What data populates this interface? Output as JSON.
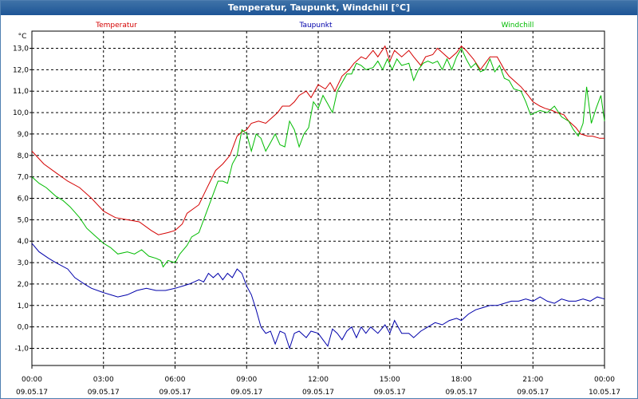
{
  "window": {
    "title": "Temperatur, Taupunkt, Windchill [°C]"
  },
  "chart_data": {
    "type": "line",
    "ylabel": "°C",
    "ylim": [
      -1.8,
      13.8
    ],
    "yticks": [
      -1.0,
      0.0,
      1.0,
      2.0,
      3.0,
      4.0,
      5.0,
      6.0,
      7.0,
      8.0,
      9.0,
      10.0,
      11.0,
      12.0,
      13.0
    ],
    "ytick_labels": [
      "-1,0",
      "0,0",
      "1,0",
      "2,0",
      "3,0",
      "4,0",
      "5,0",
      "6,0",
      "7,0",
      "8,0",
      "9,0",
      "10,0",
      "11,0",
      "12,0",
      "13,0"
    ],
    "xlim": [
      0,
      24
    ],
    "xticks": [
      0,
      3,
      6,
      9,
      12,
      15,
      18,
      21,
      24
    ],
    "xtick_labels": [
      {
        "time": "00:00",
        "date": "09.05.17"
      },
      {
        "time": "03:00",
        "date": "09.05.17"
      },
      {
        "time": "06:00",
        "date": "09.05.17"
      },
      {
        "time": "09:00",
        "date": "09.05.17"
      },
      {
        "time": "12:00",
        "date": "09.05.17"
      },
      {
        "time": "15:00",
        "date": "09.05.17"
      },
      {
        "time": "18:00",
        "date": "09.05.17"
      },
      {
        "time": "21:00",
        "date": "09.05.17"
      },
      {
        "time": "00:00",
        "date": "10.05.17"
      }
    ],
    "grid": true,
    "series": [
      {
        "name": "Temperatur",
        "color": "#d40000",
        "points": [
          [
            0,
            8.2
          ],
          [
            0.5,
            7.6
          ],
          [
            1,
            7.2
          ],
          [
            1.5,
            6.8
          ],
          [
            2,
            6.5
          ],
          [
            2.5,
            6.0
          ],
          [
            3,
            5.4
          ],
          [
            3.5,
            5.1
          ],
          [
            4,
            5.0
          ],
          [
            4.5,
            4.9
          ],
          [
            5,
            4.5
          ],
          [
            5.3,
            4.3
          ],
          [
            5.7,
            4.4
          ],
          [
            6,
            4.5
          ],
          [
            6.3,
            4.8
          ],
          [
            6.5,
            5.3
          ],
          [
            7,
            5.7
          ],
          [
            7.3,
            6.4
          ],
          [
            7.7,
            7.3
          ],
          [
            8,
            7.6
          ],
          [
            8.3,
            8.0
          ],
          [
            8.6,
            8.9
          ],
          [
            8.8,
            9.1
          ],
          [
            9,
            9.2
          ],
          [
            9.2,
            9.5
          ],
          [
            9.5,
            9.6
          ],
          [
            9.8,
            9.5
          ],
          [
            10,
            9.7
          ],
          [
            10.3,
            10.0
          ],
          [
            10.5,
            10.3
          ],
          [
            10.8,
            10.3
          ],
          [
            11,
            10.5
          ],
          [
            11.2,
            10.8
          ],
          [
            11.5,
            11.0
          ],
          [
            11.7,
            10.7
          ],
          [
            12,
            11.3
          ],
          [
            12.3,
            11.1
          ],
          [
            12.5,
            11.4
          ],
          [
            12.7,
            11.0
          ],
          [
            13,
            11.7
          ],
          [
            13.3,
            12.0
          ],
          [
            13.5,
            12.3
          ],
          [
            13.8,
            12.6
          ],
          [
            14,
            12.5
          ],
          [
            14.3,
            12.9
          ],
          [
            14.5,
            12.6
          ],
          [
            14.8,
            13.1
          ],
          [
            15,
            12.4
          ],
          [
            15.2,
            12.9
          ],
          [
            15.5,
            12.6
          ],
          [
            15.8,
            12.9
          ],
          [
            16,
            12.6
          ],
          [
            16.3,
            12.2
          ],
          [
            16.5,
            12.6
          ],
          [
            16.8,
            12.7
          ],
          [
            17,
            13.0
          ],
          [
            17.2,
            12.8
          ],
          [
            17.5,
            12.5
          ],
          [
            17.8,
            12.8
          ],
          [
            18,
            13.1
          ],
          [
            18.2,
            12.9
          ],
          [
            18.5,
            12.5
          ],
          [
            18.8,
            12.0
          ],
          [
            19,
            12.3
          ],
          [
            19.2,
            12.6
          ],
          [
            19.5,
            12.6
          ],
          [
            19.8,
            12.0
          ],
          [
            20,
            11.7
          ],
          [
            20.3,
            11.4
          ],
          [
            20.5,
            11.2
          ],
          [
            20.8,
            10.8
          ],
          [
            21,
            10.5
          ],
          [
            21.3,
            10.3
          ],
          [
            21.5,
            10.2
          ],
          [
            21.8,
            10.1
          ],
          [
            22,
            10.0
          ],
          [
            22.3,
            9.9
          ],
          [
            22.5,
            9.6
          ],
          [
            22.8,
            9.3
          ],
          [
            23,
            9.0
          ],
          [
            23.3,
            8.9
          ],
          [
            23.5,
            8.9
          ],
          [
            23.8,
            8.8
          ],
          [
            24,
            8.8
          ]
        ]
      },
      {
        "name": "Taupunkt",
        "color": "#0000aa",
        "points": [
          [
            0,
            3.9
          ],
          [
            0.3,
            3.5
          ],
          [
            0.7,
            3.2
          ],
          [
            1,
            3.0
          ],
          [
            1.5,
            2.7
          ],
          [
            1.8,
            2.3
          ],
          [
            2.2,
            2.0
          ],
          [
            2.5,
            1.8
          ],
          [
            3,
            1.6
          ],
          [
            3.3,
            1.5
          ],
          [
            3.6,
            1.4
          ],
          [
            4,
            1.5
          ],
          [
            4.4,
            1.7
          ],
          [
            4.8,
            1.8
          ],
          [
            5.2,
            1.7
          ],
          [
            5.6,
            1.7
          ],
          [
            6,
            1.8
          ],
          [
            6.3,
            1.9
          ],
          [
            6.6,
            2.0
          ],
          [
            6.8,
            2.1
          ],
          [
            7,
            2.2
          ],
          [
            7.2,
            2.1
          ],
          [
            7.4,
            2.5
          ],
          [
            7.6,
            2.3
          ],
          [
            7.8,
            2.5
          ],
          [
            8,
            2.2
          ],
          [
            8.2,
            2.5
          ],
          [
            8.4,
            2.3
          ],
          [
            8.6,
            2.7
          ],
          [
            8.8,
            2.5
          ],
          [
            9,
            1.9
          ],
          [
            9.2,
            1.5
          ],
          [
            9.4,
            0.8
          ],
          [
            9.6,
            0.0
          ],
          [
            9.8,
            -0.3
          ],
          [
            10,
            -0.2
          ],
          [
            10.2,
            -0.8
          ],
          [
            10.4,
            -0.2
          ],
          [
            10.6,
            -0.3
          ],
          [
            10.8,
            -1.0
          ],
          [
            11,
            -0.3
          ],
          [
            11.2,
            -0.2
          ],
          [
            11.5,
            -0.5
          ],
          [
            11.7,
            -0.2
          ],
          [
            12,
            -0.3
          ],
          [
            12.2,
            -0.6
          ],
          [
            12.4,
            -0.9
          ],
          [
            12.6,
            -0.1
          ],
          [
            12.8,
            -0.3
          ],
          [
            13,
            -0.6
          ],
          [
            13.2,
            -0.2
          ],
          [
            13.4,
            0.0
          ],
          [
            13.6,
            -0.5
          ],
          [
            13.8,
            0.0
          ],
          [
            14,
            -0.3
          ],
          [
            14.2,
            0.0
          ],
          [
            14.5,
            -0.3
          ],
          [
            14.8,
            0.1
          ],
          [
            15,
            -0.3
          ],
          [
            15.2,
            0.3
          ],
          [
            15.5,
            -0.3
          ],
          [
            15.8,
            -0.3
          ],
          [
            16,
            -0.5
          ],
          [
            16.3,
            -0.2
          ],
          [
            16.6,
            0.0
          ],
          [
            16.9,
            0.2
          ],
          [
            17.2,
            0.1
          ],
          [
            17.5,
            0.3
          ],
          [
            17.8,
            0.4
          ],
          [
            18,
            0.3
          ],
          [
            18.3,
            0.6
          ],
          [
            18.6,
            0.8
          ],
          [
            18.9,
            0.9
          ],
          [
            19.2,
            1.0
          ],
          [
            19.5,
            1.0
          ],
          [
            19.8,
            1.1
          ],
          [
            20.1,
            1.2
          ],
          [
            20.4,
            1.2
          ],
          [
            20.7,
            1.3
          ],
          [
            21,
            1.2
          ],
          [
            21.3,
            1.4
          ],
          [
            21.6,
            1.2
          ],
          [
            21.9,
            1.1
          ],
          [
            22.2,
            1.3
          ],
          [
            22.5,
            1.2
          ],
          [
            22.8,
            1.2
          ],
          [
            23.1,
            1.3
          ],
          [
            23.4,
            1.2
          ],
          [
            23.7,
            1.4
          ],
          [
            24,
            1.3
          ]
        ]
      },
      {
        "name": "Windchill",
        "color": "#00bb00",
        "points": [
          [
            0,
            7.0
          ],
          [
            0.3,
            6.7
          ],
          [
            0.6,
            6.5
          ],
          [
            1,
            6.1
          ],
          [
            1.3,
            5.9
          ],
          [
            1.6,
            5.6
          ],
          [
            2,
            5.1
          ],
          [
            2.3,
            4.6
          ],
          [
            2.6,
            4.3
          ],
          [
            3,
            3.9
          ],
          [
            3.3,
            3.7
          ],
          [
            3.6,
            3.4
          ],
          [
            4,
            3.5
          ],
          [
            4.3,
            3.4
          ],
          [
            4.6,
            3.6
          ],
          [
            4.9,
            3.3
          ],
          [
            5.2,
            3.2
          ],
          [
            5.4,
            3.1
          ],
          [
            5.5,
            2.8
          ],
          [
            5.7,
            3.1
          ],
          [
            6,
            3.0
          ],
          [
            6.2,
            3.4
          ],
          [
            6.5,
            3.8
          ],
          [
            6.7,
            4.2
          ],
          [
            7,
            4.4
          ],
          [
            7.2,
            5.0
          ],
          [
            7.5,
            5.9
          ],
          [
            7.8,
            6.8
          ],
          [
            8,
            6.8
          ],
          [
            8.2,
            6.7
          ],
          [
            8.4,
            7.6
          ],
          [
            8.6,
            8.0
          ],
          [
            8.8,
            9.2
          ],
          [
            9,
            9.0
          ],
          [
            9.2,
            8.2
          ],
          [
            9.4,
            9.0
          ],
          [
            9.6,
            8.8
          ],
          [
            9.8,
            8.2
          ],
          [
            10,
            8.6
          ],
          [
            10.2,
            9.0
          ],
          [
            10.4,
            8.5
          ],
          [
            10.6,
            8.4
          ],
          [
            10.8,
            9.6
          ],
          [
            11,
            9.2
          ],
          [
            11.2,
            8.4
          ],
          [
            11.4,
            9.0
          ],
          [
            11.6,
            9.3
          ],
          [
            11.8,
            10.5
          ],
          [
            12,
            10.2
          ],
          [
            12.2,
            10.8
          ],
          [
            12.4,
            10.4
          ],
          [
            12.6,
            10.0
          ],
          [
            12.8,
            11.0
          ],
          [
            13,
            11.4
          ],
          [
            13.2,
            11.8
          ],
          [
            13.4,
            11.8
          ],
          [
            13.6,
            12.3
          ],
          [
            13.8,
            12.2
          ],
          [
            14,
            12.0
          ],
          [
            14.3,
            12.1
          ],
          [
            14.5,
            12.4
          ],
          [
            14.7,
            12.0
          ],
          [
            14.9,
            12.5
          ],
          [
            15.1,
            12.0
          ],
          [
            15.3,
            12.5
          ],
          [
            15.5,
            12.2
          ],
          [
            15.8,
            12.3
          ],
          [
            16,
            11.5
          ],
          [
            16.2,
            12.0
          ],
          [
            16.4,
            12.3
          ],
          [
            16.6,
            12.4
          ],
          [
            16.8,
            12.3
          ],
          [
            17,
            12.4
          ],
          [
            17.2,
            12.0
          ],
          [
            17.4,
            12.5
          ],
          [
            17.6,
            12.0
          ],
          [
            17.8,
            12.6
          ],
          [
            18,
            13.0
          ],
          [
            18.2,
            12.5
          ],
          [
            18.4,
            12.1
          ],
          [
            18.6,
            12.3
          ],
          [
            18.8,
            11.9
          ],
          [
            19,
            12.0
          ],
          [
            19.2,
            12.5
          ],
          [
            19.4,
            11.9
          ],
          [
            19.6,
            12.2
          ],
          [
            19.8,
            11.6
          ],
          [
            20,
            11.5
          ],
          [
            20.2,
            11.1
          ],
          [
            20.5,
            11.0
          ],
          [
            20.7,
            10.5
          ],
          [
            20.9,
            9.9
          ],
          [
            21.1,
            10.0
          ],
          [
            21.3,
            10.1
          ],
          [
            21.6,
            10.0
          ],
          [
            21.9,
            10.3
          ],
          [
            22.2,
            9.8
          ],
          [
            22.5,
            9.6
          ],
          [
            22.7,
            9.2
          ],
          [
            22.9,
            8.9
          ],
          [
            23.1,
            9.5
          ],
          [
            23.25,
            11.2
          ],
          [
            23.45,
            9.5
          ],
          [
            23.65,
            10.2
          ],
          [
            23.85,
            10.8
          ],
          [
            24,
            9.6
          ]
        ]
      }
    ]
  }
}
